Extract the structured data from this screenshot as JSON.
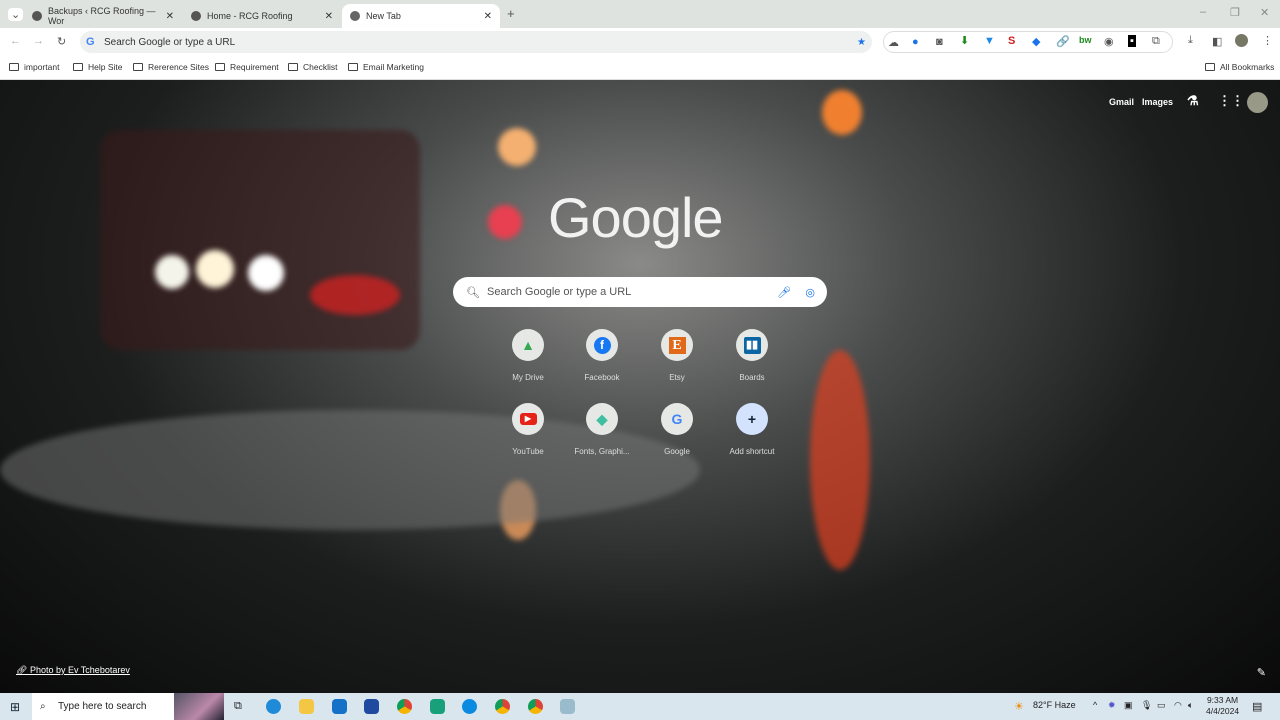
{
  "tabs": [
    {
      "title": "Backups ‹ RCG Roofing — Wor"
    },
    {
      "title": "Home - RCG Roofing"
    },
    {
      "title": "New Tab",
      "active": true
    }
  ],
  "omnibox": {
    "placeholder": "Search Google or type a URL"
  },
  "bookmarks": [
    "important",
    "Help Site",
    "Rererence Sites",
    "Requirement",
    "Checklist",
    "Email Marketing"
  ],
  "all_bookmarks": "All Bookmarks",
  "ntp": {
    "logo": "Google",
    "gmail": "Gmail",
    "images": "Images",
    "search_placeholder": "Search Google or type a URL",
    "shortcuts": [
      {
        "label": "My Drive",
        "icon": "drive-icon"
      },
      {
        "label": "Facebook",
        "icon": "facebook-icon"
      },
      {
        "label": "Etsy",
        "icon": "etsy-icon"
      },
      {
        "label": "Boards",
        "icon": "trello-icon"
      },
      {
        "label": "YouTube",
        "icon": "youtube-icon"
      },
      {
        "label": "Fonts, Graphi...",
        "icon": "tag-icon"
      },
      {
        "label": "Google",
        "icon": "google-icon"
      },
      {
        "label": "Add shortcut",
        "icon": "plus-icon"
      }
    ],
    "photo_credit": "Photo by Ev Tchebotarev"
  },
  "taskbar": {
    "search_placeholder": "Type here to search",
    "weather": "82°F  Haze",
    "time": "9:33 AM",
    "date": "4/4/2024"
  }
}
